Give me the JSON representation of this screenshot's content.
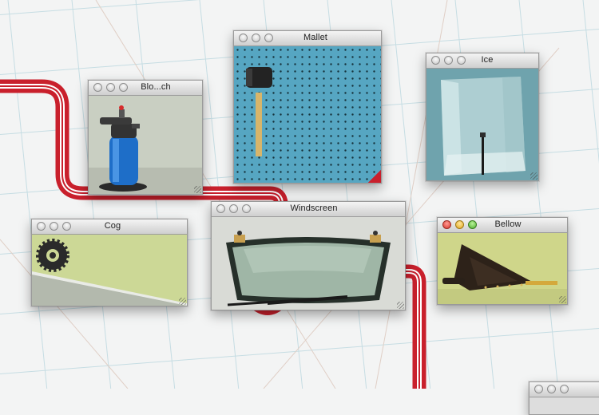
{
  "canvas": {
    "background": "#f3f4f4",
    "grid_color": "#c6dde3",
    "wire_color": "#cc2233"
  },
  "windows": {
    "blowtorch": {
      "title": "Blo...ch"
    },
    "mallet": {
      "title": "Mallet"
    },
    "ice": {
      "title": "Ice"
    },
    "cog": {
      "title": "Cog"
    },
    "windscreen": {
      "title": "Windscreen"
    },
    "bellow": {
      "title": "Bellow"
    }
  }
}
